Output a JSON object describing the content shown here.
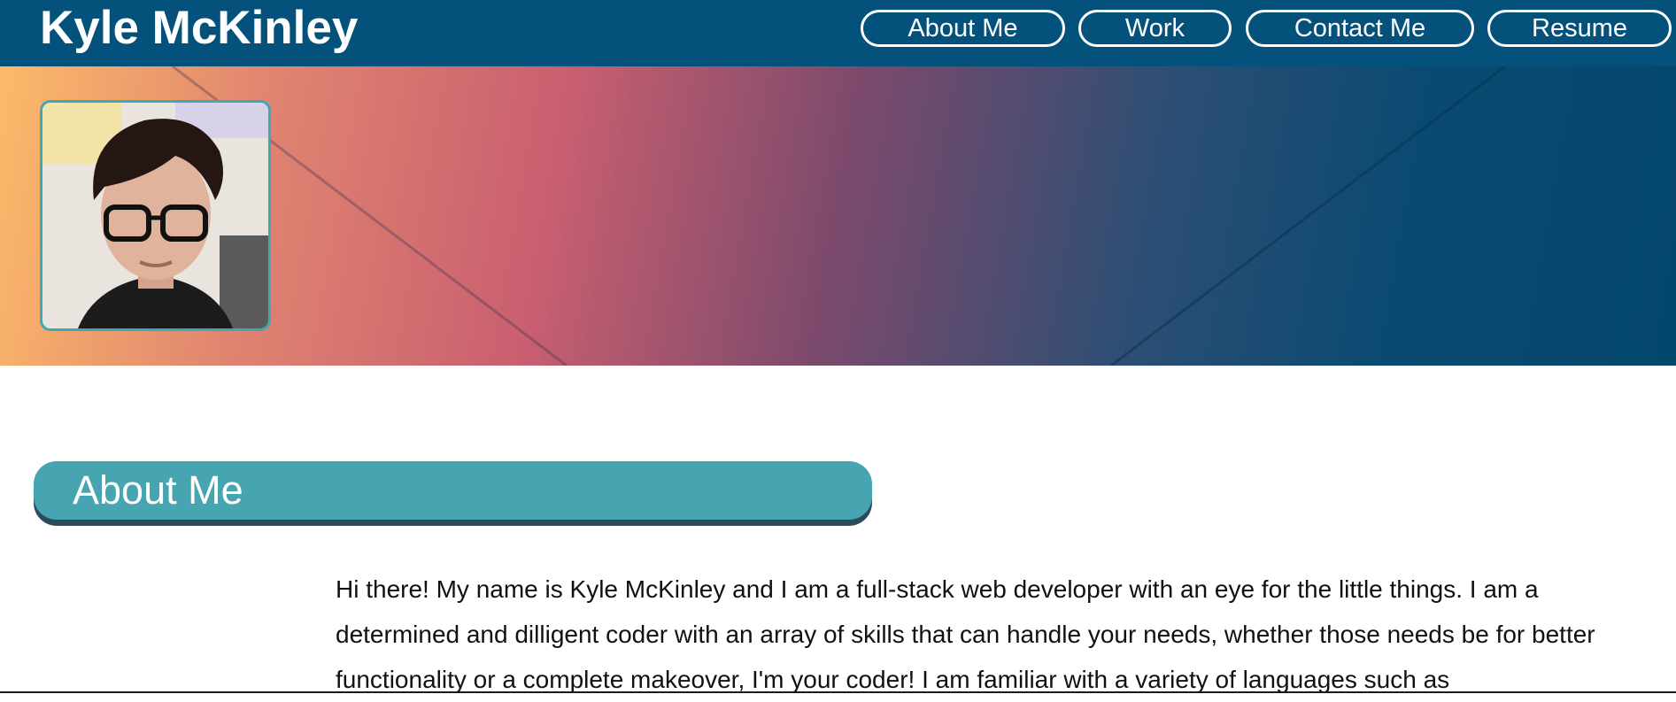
{
  "header": {
    "title": "Kyle McKinley",
    "nav": [
      {
        "label": "About Me"
      },
      {
        "label": "Work"
      },
      {
        "label": "Contact Me"
      },
      {
        "label": "Resume"
      }
    ]
  },
  "colors": {
    "header_bg": "#04527c",
    "accent": "#47a4b1",
    "header_shadow": "#2d4a5c",
    "hero_gradient": [
      "#fcba69",
      "#c95f70",
      "#7c4a6c",
      "#04476d"
    ]
  },
  "icons": {
    "portrait": "profile-photo"
  },
  "about": {
    "heading": "About Me",
    "text": "Hi there! My name is Kyle McKinley and I am a full-stack web developer with an eye for the little things. I am a determined and dilligent coder with an array of skills that can handle your needs, whether those needs be for better functionality or a complete makeover, I'm your coder! I am familiar with a variety of languages such as"
  }
}
